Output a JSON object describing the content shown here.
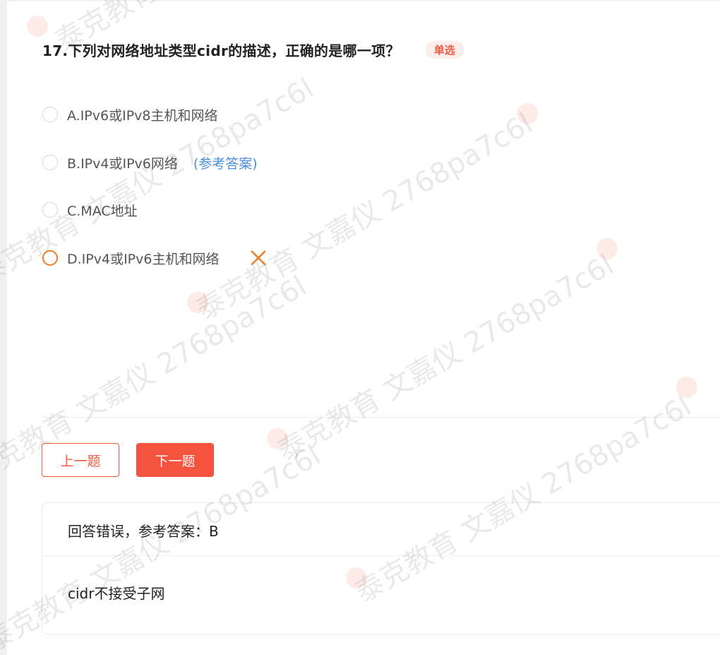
{
  "question": {
    "title": "17.下列对网络地址类型cidr的描述，正确的是哪一项？",
    "type_badge": "单选",
    "options": [
      {
        "label": "A.IPv6或IPv8主机和网络",
        "state": "unselected"
      },
      {
        "label": "B.IPv4或IPv6网络",
        "state": "unselected",
        "reference_tag": "(参考答案)"
      },
      {
        "label": "C.MAC地址",
        "state": "unselected"
      },
      {
        "label": "D.IPv4或IPv6主机和网络",
        "state": "selected-wrong",
        "mark_icon": "x-mark-icon"
      }
    ]
  },
  "nav": {
    "prev_label": "上一题",
    "next_label": "下一题"
  },
  "result": {
    "status": "回答错误，参考答案：B",
    "explanation": "cidr不接受子网"
  },
  "watermark": {
    "text": "泰克教育 文嘉仪 2768pa7c6l"
  },
  "colors": {
    "accent": "#f5533d",
    "badge_bg": "#fdeeec",
    "reference": "#4a8ee0",
    "wrong": "#f07c26"
  }
}
